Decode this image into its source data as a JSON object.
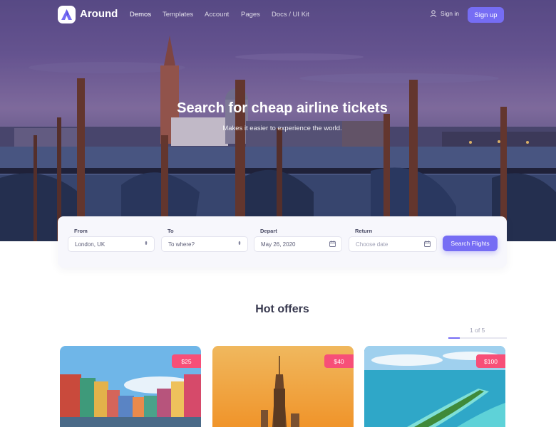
{
  "brand": {
    "name": "Around",
    "accent": "#766df4",
    "price_color": "#f74f78"
  },
  "nav": {
    "links": [
      "Demos",
      "Templates",
      "Account",
      "Pages",
      "Docs / UI Kit"
    ],
    "signin": "Sign in",
    "signup": "Sign up"
  },
  "hero": {
    "title": "Search for cheap airline tickets",
    "subtitle": "Makes it easier to experience the world."
  },
  "search": {
    "from": {
      "label": "From",
      "value": "London, UK",
      "icon": "select-arrows-icon"
    },
    "to": {
      "label": "To",
      "placeholder": "To where?",
      "icon": "select-arrows-icon"
    },
    "depart": {
      "label": "Depart",
      "value": "May 26, 2020",
      "icon": "calendar-icon"
    },
    "return": {
      "label": "Return",
      "placeholder": "Choose date",
      "icon": "calendar-icon"
    },
    "button": "Search Flights"
  },
  "offers": {
    "title": "Hot offers",
    "pager": "1 of 5",
    "progress": 0.2,
    "cards": [
      {
        "price": "$25"
      },
      {
        "price": "$40"
      },
      {
        "price": "$100"
      }
    ]
  }
}
